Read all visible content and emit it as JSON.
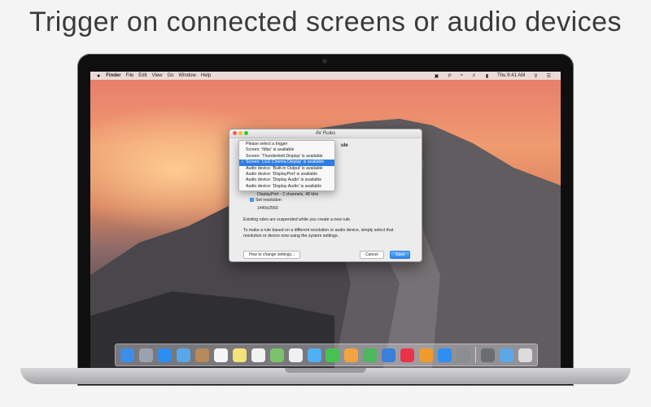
{
  "headline": "Trigger on connected screens or audio devices",
  "menubar": {
    "apple": "",
    "items": [
      "Finder",
      "File",
      "Edit",
      "View",
      "Go",
      "Window",
      "Help"
    ],
    "clock": "Thu 9:41 AM"
  },
  "window": {
    "title": "AV Rules",
    "partial_title_suffix": "ule",
    "detail_line": "DisplayPort - 2 channels, 48 kHz",
    "set_resolution_label": "Set resolution",
    "resolution_value": "1440x2560",
    "suspended_text": "Existing rules are suspended while you create a new rule.",
    "info_text_1": "To make a rule based on a different resolution or audio device, simply select that",
    "info_text_2": "resolution or device now using the system settings.",
    "buttons": {
      "how_to": "How to change settings...",
      "cancel": "Cancel",
      "save": "Save"
    }
  },
  "dropdown": {
    "items": [
      "Please select a trigger",
      "Screen: 'iMac' is available",
      "Screen: 'Thunderbolt Display' is available",
      "Screen: 'LED Cinema Display' is available",
      "Audio device: 'Built-in Output' is available",
      "Audio device: 'DisplayPort' is available",
      "Audio device: 'Display Audio' is available",
      "Audio device: 'Display Audio' is available"
    ],
    "selected_index": 3,
    "check_mark": "✓"
  },
  "dock": {
    "icons": [
      {
        "name": "finder-icon",
        "color": "#3b8fe6"
      },
      {
        "name": "launchpad-icon",
        "color": "#9aa3ad"
      },
      {
        "name": "safari-icon",
        "color": "#2e8ef0"
      },
      {
        "name": "mail-icon",
        "color": "#5aa7e8"
      },
      {
        "name": "contacts-icon",
        "color": "#b8895a"
      },
      {
        "name": "calendar-icon",
        "color": "#f5f5f5"
      },
      {
        "name": "notes-icon",
        "color": "#f4e27a"
      },
      {
        "name": "reminders-icon",
        "color": "#f2f2f2"
      },
      {
        "name": "maps-icon",
        "color": "#7cc26a"
      },
      {
        "name": "photos-icon",
        "color": "#f0f0f0"
      },
      {
        "name": "messages-icon",
        "color": "#4fb0f5"
      },
      {
        "name": "facetime-icon",
        "color": "#48c154"
      },
      {
        "name": "pages-icon",
        "color": "#f5a340"
      },
      {
        "name": "numbers-icon",
        "color": "#4db760"
      },
      {
        "name": "keynote-icon",
        "color": "#3a7fd8"
      },
      {
        "name": "itunes-icon",
        "color": "#e8334b"
      },
      {
        "name": "ibooks-icon",
        "color": "#f19a2c"
      },
      {
        "name": "app-store-icon",
        "color": "#2f8ef2"
      },
      {
        "name": "system-preferences-icon",
        "color": "#8a8d91"
      },
      {
        "name": "av-rules-icon",
        "color": "#6a6d71"
      },
      {
        "name": "downloads-folder-icon",
        "color": "#5aa9e6"
      },
      {
        "name": "trash-icon",
        "color": "#dcdcdc"
      }
    ]
  }
}
